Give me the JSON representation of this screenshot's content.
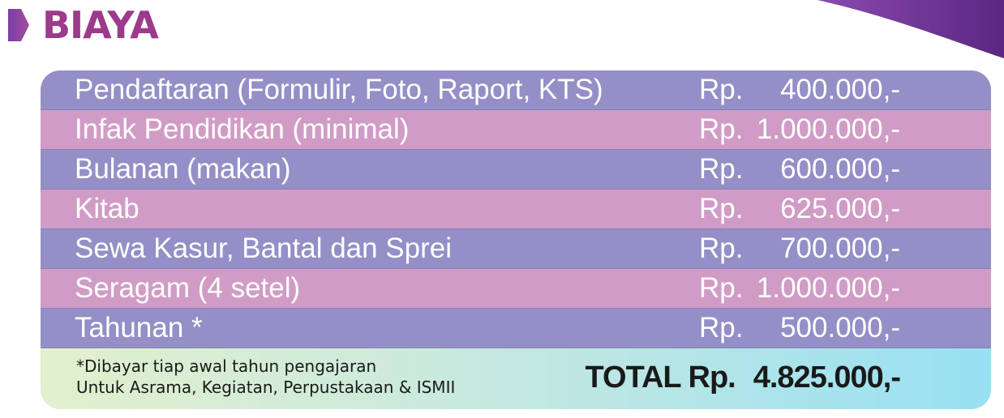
{
  "header": {
    "title": "BIAYA"
  },
  "colors": {
    "title": "#9c3a8c",
    "row_purple": "#948fc6",
    "row_pink": "#d09cc5",
    "swoosh": "#6a2d8c"
  },
  "fees": [
    {
      "label": "Pendaftaran (Formulir, Foto, Raport, KTS)",
      "currency": "Rp.",
      "amount": "400.000,-"
    },
    {
      "label": "Infak Pendidikan (minimal)",
      "currency": "Rp.",
      "amount": "1.000.000,-"
    },
    {
      "label": "Bulanan (makan)",
      "currency": "Rp.",
      "amount": "600.000,-"
    },
    {
      "label": "Kitab",
      "currency": "Rp.",
      "amount": "625.000,-"
    },
    {
      "label": "Sewa Kasur, Bantal dan Sprei",
      "currency": "Rp.",
      "amount": "700.000,-"
    },
    {
      "label": "Seragam (4 setel)",
      "currency": "Rp.",
      "amount": "1.000.000,-"
    },
    {
      "label": "Tahunan *",
      "currency": "Rp.",
      "amount": "500.000,-"
    }
  ],
  "footer": {
    "note_line1": "*Dibayar tiap awal tahun pengajaran",
    "note_line2": "Untuk Asrama, Kegiatan, Perpustakaan & ISMII",
    "total_label": "TOTAL Rp.",
    "total_amount": "4.825.000,-"
  }
}
